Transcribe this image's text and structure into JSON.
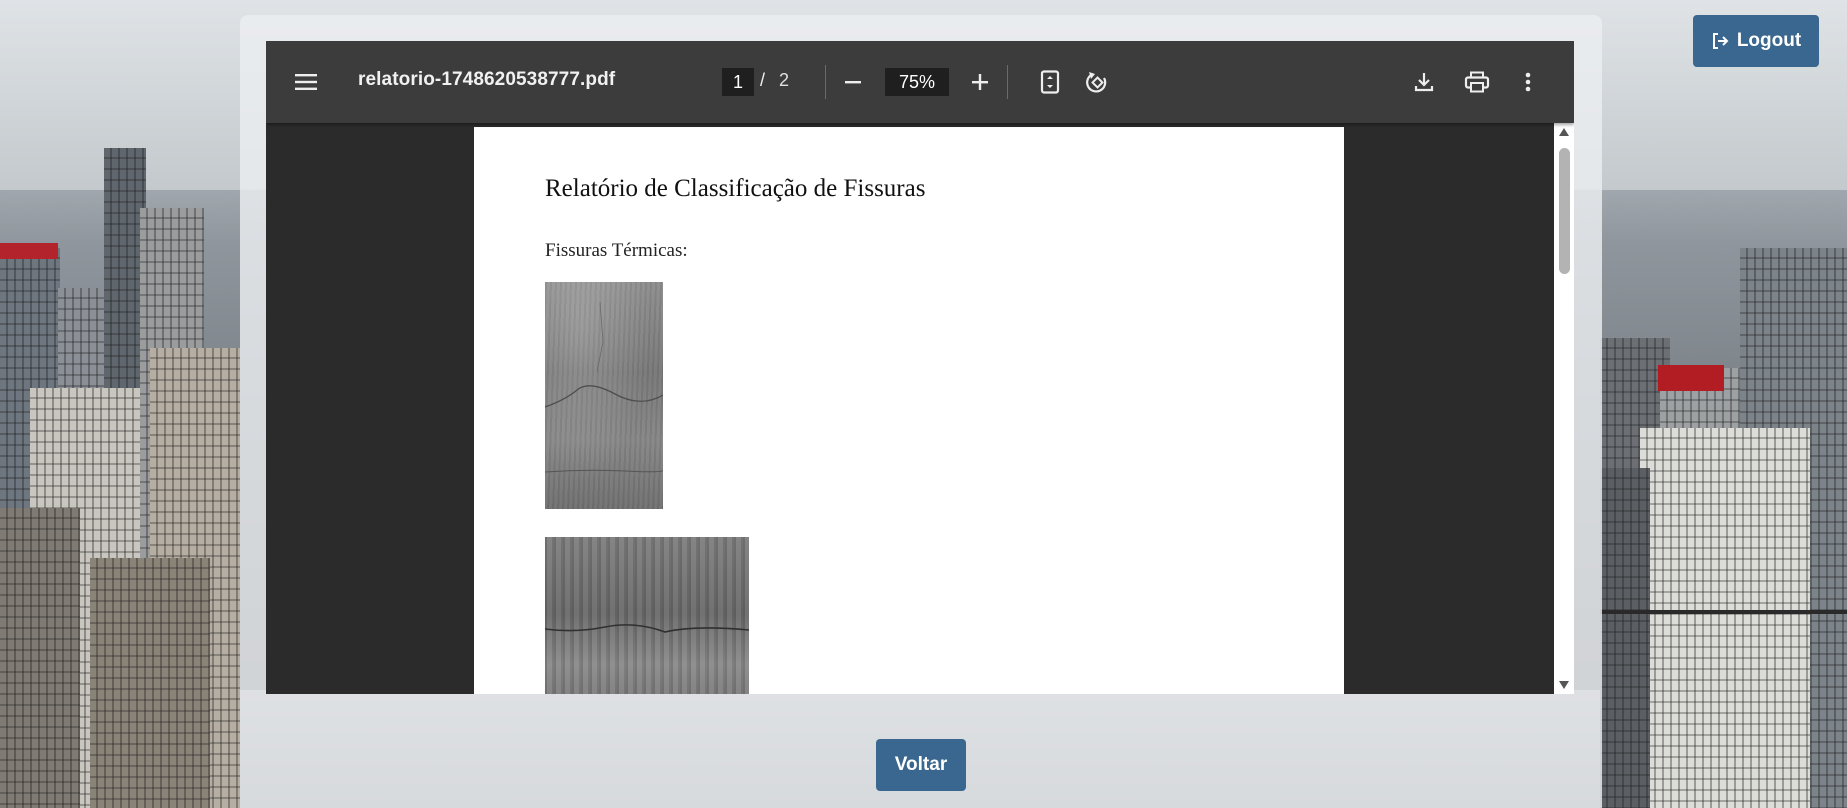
{
  "viewer": {
    "filename": "relatorio-1748620538777.pdf",
    "current_page": "1",
    "page_separator": "/",
    "total_pages": "2",
    "zoom": "75%"
  },
  "document": {
    "title": "Relatório de Classificação de Fissuras",
    "section": "Fissuras Térmicas:"
  },
  "buttons": {
    "back": "Voltar",
    "logout": "Logout"
  },
  "icons": {
    "menu": "menu-icon",
    "zoom_out": "minus-icon",
    "zoom_in": "plus-icon",
    "fit": "fit-page-icon",
    "rotate": "rotate-icon",
    "download": "download-icon",
    "print": "print-icon",
    "more": "more-vertical-icon",
    "logout": "logout-icon"
  },
  "colors": {
    "toolbar": "#3c3c3c",
    "viewer_bg": "#2b2b2b",
    "accent_button": "#3a678f"
  }
}
